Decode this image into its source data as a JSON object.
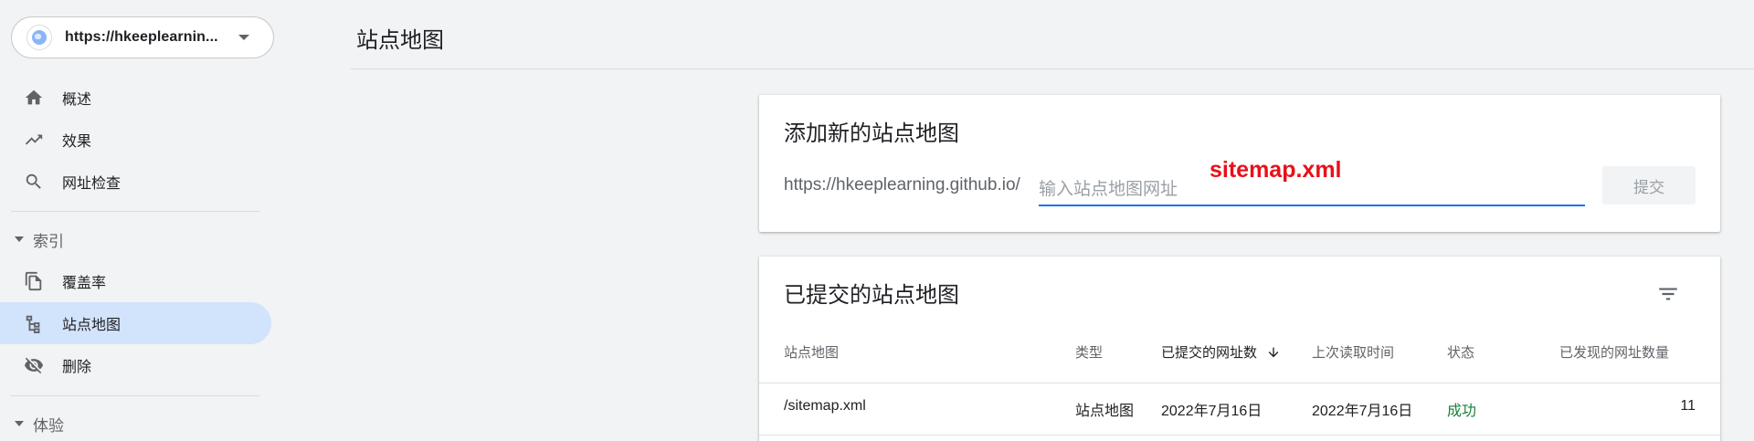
{
  "property": {
    "url": "https://hkeeplearnin..."
  },
  "sidebar": {
    "items": [
      {
        "label": "概述"
      },
      {
        "label": "效果"
      },
      {
        "label": "网址检查"
      },
      {
        "label": "覆盖率"
      },
      {
        "label": "站点地图"
      },
      {
        "label": "删除"
      }
    ],
    "sections": [
      {
        "label": "索引"
      },
      {
        "label": "体验"
      }
    ]
  },
  "header": {
    "title": "站点地图"
  },
  "add_card": {
    "title": "添加新的站点地图",
    "url_prefix": "https://hkeeplearning.github.io/",
    "input_placeholder": "输入站点地图网址",
    "input_value": "",
    "annotation": "sitemap.xml",
    "submit_label": "提交"
  },
  "submitted_card": {
    "title": "已提交的站点地图",
    "columns": [
      "站点地图",
      "类型",
      "已提交的网址数",
      "上次读取时间",
      "状态",
      "已发现的网址数量"
    ],
    "rows": [
      {
        "sitemap": "/sitemap.xml",
        "type": "站点地图",
        "submitted": "2022年7月16日",
        "last_read": "2022年7月16日",
        "status": "成功",
        "discovered": "11"
      }
    ]
  },
  "colors": {
    "accent": "#1a73e8",
    "active_nav": "#d2e3fc",
    "success": "#188038",
    "annotation": "#e8101a"
  }
}
